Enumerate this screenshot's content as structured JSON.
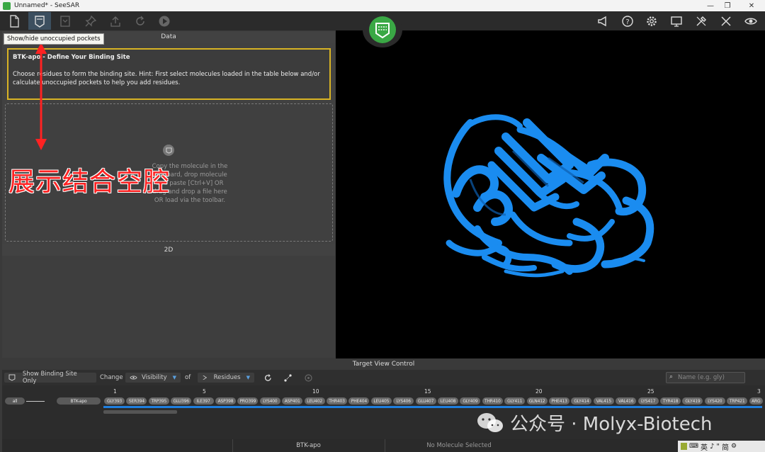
{
  "window": {
    "title": "Unnamed* - SeeSAR"
  },
  "toolbar": {
    "tooltip": "Show/hide unoccupied pockets"
  },
  "left_panel": {
    "data_header": "Data",
    "info_title": "BTK-apo - Define Your Binding Site",
    "info_body": "Choose residues to form the binding site. Hint: First select molecules loaded in the table below and/or calculate unoccupied pockets to help you add residues.",
    "drop_lines": [
      "Copy the molecule in the",
      "clipboard, drop molecule",
      "and paste [Ctrl+V] OR",
      "drag and drop a file here",
      "OR load via the toolbar."
    ],
    "twod_header": "2D"
  },
  "annotation": {
    "cn_label": "展示结合空腔"
  },
  "bottom": {
    "tvc_header": "Target View Control",
    "show_binding_site": "Show Binding Site Only",
    "change_label": "Change",
    "visibility_label": "Visibility",
    "of_label": "of",
    "residues_label": "Residues",
    "search_placeholder": "Name (e.g. gly)",
    "all_label": "all",
    "chain_label": "BTK-apo",
    "ruler": [
      "1",
      "5",
      "10",
      "15",
      "20",
      "25",
      "3"
    ],
    "residues": [
      "GLY393",
      "SER394",
      "TRP395",
      "GLU396",
      "ILE397",
      "ASP398",
      "PRO399",
      "LYS400",
      "ASP401",
      "LEU402",
      "THR403",
      "PHE404",
      "LEU405",
      "LYS406",
      "GLU407",
      "LEU408",
      "GLY409",
      "THR410",
      "GLY411",
      "GLN412",
      "PHE413",
      "GLY414",
      "VAL415",
      "VAL416",
      "LYS417",
      "TYR418",
      "GLY419",
      "LYS420",
      "TRP421",
      "ARG"
    ]
  },
  "status": {
    "target": "BTK-apo",
    "molecule": "No Molecule Selected"
  },
  "watermark": {
    "text": "公众号 · Molyx-Biotech"
  },
  "ime": {
    "items": [
      "英",
      "♪",
      "\"",
      "简"
    ]
  },
  "colors": {
    "accent": "#1e7fe0",
    "highlight": "#d8b324",
    "badge": "#3aa845",
    "annotation": "#ff2222"
  }
}
